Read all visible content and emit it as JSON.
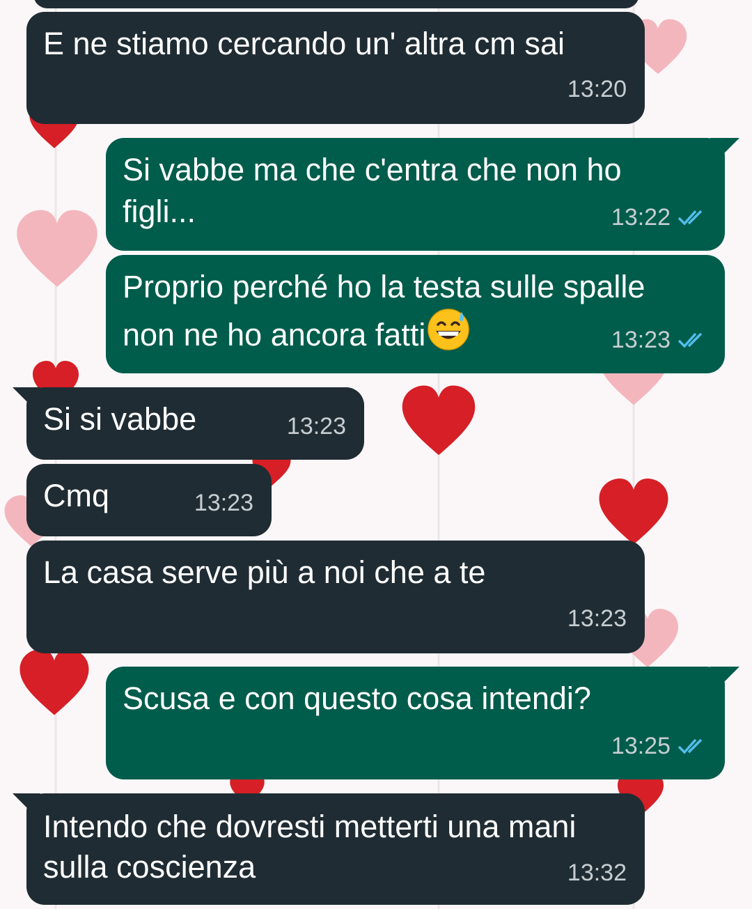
{
  "messages": [
    {
      "direction": "incoming",
      "text": "E ne stiamo cercando un' altra cm sai",
      "time": "13:20"
    },
    {
      "direction": "outgoing",
      "lines": [
        "Si vabbe ma che c'entra che non ho",
        "figli..."
      ],
      "time": "13:22",
      "status": "read"
    },
    {
      "direction": "outgoing",
      "lines": [
        "Proprio perché ho la testa sulle spalle",
        "non ne ho ancora fatti"
      ],
      "emoji": "grinning-face-with-sweat",
      "time": "13:23",
      "status": "read"
    },
    {
      "direction": "incoming",
      "text": "Si si vabbe",
      "time": "13:23"
    },
    {
      "direction": "incoming",
      "text": "Cmq",
      "time": "13:23"
    },
    {
      "direction": "incoming",
      "text": "La casa serve più a  noi che a te",
      "time": "13:23"
    },
    {
      "direction": "outgoing",
      "text": "Scusa e con questo cosa intendi?",
      "time": "13:25",
      "status": "read"
    },
    {
      "direction": "incoming",
      "lines": [
        "Intendo che dovresti metterti una mani",
        "sulla coscienza"
      ],
      "time": "13:32"
    }
  ],
  "colors": {
    "incoming_bubble": "#202c33",
    "outgoing_bubble": "#005c4b",
    "timestamp": "#c7ced2",
    "read_ticks": "#53bdeb",
    "heart_red": "#d61f26",
    "heart_pink": "#f4b6bd"
  },
  "icons": {
    "read_status": "double-check-icon",
    "emoji": "grinning-face-with-sweat-emoji"
  }
}
